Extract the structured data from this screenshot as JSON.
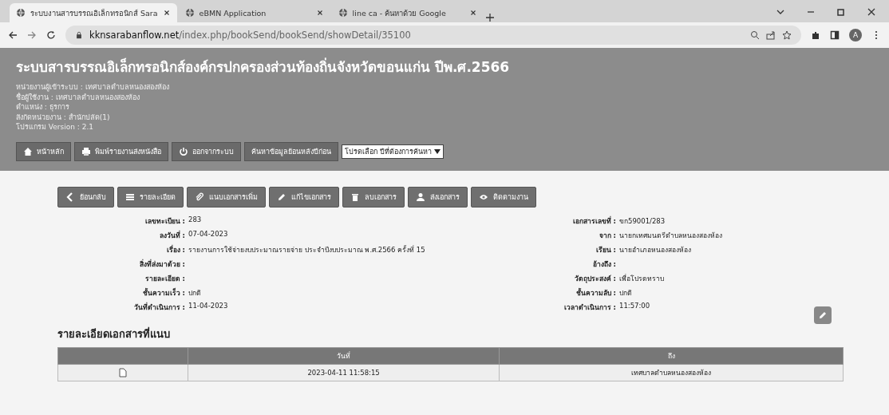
{
  "browser": {
    "tabs": [
      {
        "title": "ระบบงานสารบรรณอิเล็กทรอนิกส์ Sara",
        "selected": true
      },
      {
        "title": "eBMN Application",
        "selected": false
      },
      {
        "title": "line ca - ค้นหาด้วย Google",
        "selected": false
      }
    ],
    "url_domain": "kknsarabanflow.net",
    "url_path": "/index.php/bookSend/bookSend/showDetail/35100",
    "avatar": "A"
  },
  "header": {
    "title": "ระบบสารบรรณอิเล็กทรอนิกส์องค์กรปกครองส่วนท้องถิ่นจังหวัดขอนแก่น ปีพ.ศ.2566",
    "info": [
      {
        "label": "หน่วยงานผู้เข้าระบบ :",
        "value": "เทศบาลตำบลหนองสองห้อง"
      },
      {
        "label": "ชื่อผู้ใช้งาน :",
        "value": "เทศบาลตำบลหนองสองห้อง"
      },
      {
        "label": "ตำแหน่ง :",
        "value": "ธุรการ"
      },
      {
        "label": "สังกัดหน่วยงาน :",
        "value": "สำนักปลัด(1)"
      },
      {
        "label": "โปรแกรม Version :",
        "value": "2.1"
      }
    ],
    "nav": [
      {
        "kind": "home",
        "label": "หน้าหลัก"
      },
      {
        "kind": "print",
        "label": "พิมพ์รายงานส่งหนังสือ"
      },
      {
        "kind": "logout",
        "label": "ออกจากระบบ"
      },
      {
        "kind": "plain",
        "label": "ค้นหาข้อมูลย้อนหลังปีก่อน"
      }
    ],
    "year_select": "โปรดเลือก ปีที่ต้องการค้นหา"
  },
  "actions": [
    {
      "kind": "back",
      "label": "ย้อนกลับ"
    },
    {
      "kind": "list",
      "label": "รายละเอียด"
    },
    {
      "kind": "attach",
      "label": "แนบเอกสารเพิ่ม"
    },
    {
      "kind": "edit",
      "label": "แก้ไขเอกสาร"
    },
    {
      "kind": "delete",
      "label": "ลบเอกสาร"
    },
    {
      "kind": "send",
      "label": "ส่งเอกสาร"
    },
    {
      "kind": "track",
      "label": "ติดตามงาน"
    }
  ],
  "fields_left": [
    {
      "label": "เลขทะเบียน :",
      "value": "283"
    },
    {
      "label": "ลงวันที่ :",
      "value": "07-04-2023"
    },
    {
      "label": "เรื่อง :",
      "value": "รายงานการใช้จ่ายงบประมาณรายจ่าย ประจำปีงบประมาณ พ.ศ.2566 ครั้งที่ 15"
    },
    {
      "label": "สิ่งที่ส่งมาด้วย :"
    },
    {
      "label": "รายละเอียด :"
    },
    {
      "label": "ชั้นความเร็ว :",
      "value": "ปกติ"
    },
    {
      "label": "วันที่ดำเนินการ :",
      "value": "11-04-2023"
    }
  ],
  "fields_right": [
    {
      "label": "เอกสารเลขที่ :",
      "value": "ขก59001/283"
    },
    {
      "label": "จาก :",
      "value": "นายกเทศมนตรีตำบลหนองสองห้อง"
    },
    {
      "label": "เรียน :",
      "value": "นายอำเภอหนองสองห้อง"
    },
    {
      "label": "อ้างถึง :"
    },
    {
      "label": "วัตถุประสงค์ :",
      "value": "เพื่อโปรดทราบ"
    },
    {
      "label": "ชั้นความลับ :",
      "value": "ปกติ"
    },
    {
      "label": "เวลาดำเนินการ :",
      "value": "11:57:00"
    }
  ],
  "attachments": {
    "title": "รายละเอียดเอกสารที่แนบ",
    "columns": [
      "วันที่",
      "ถึง"
    ],
    "rows": [
      {
        "date": "2023-04-11 11:58:15",
        "to": "เทศบาลตำบลหนองสองห้อง"
      }
    ]
  }
}
